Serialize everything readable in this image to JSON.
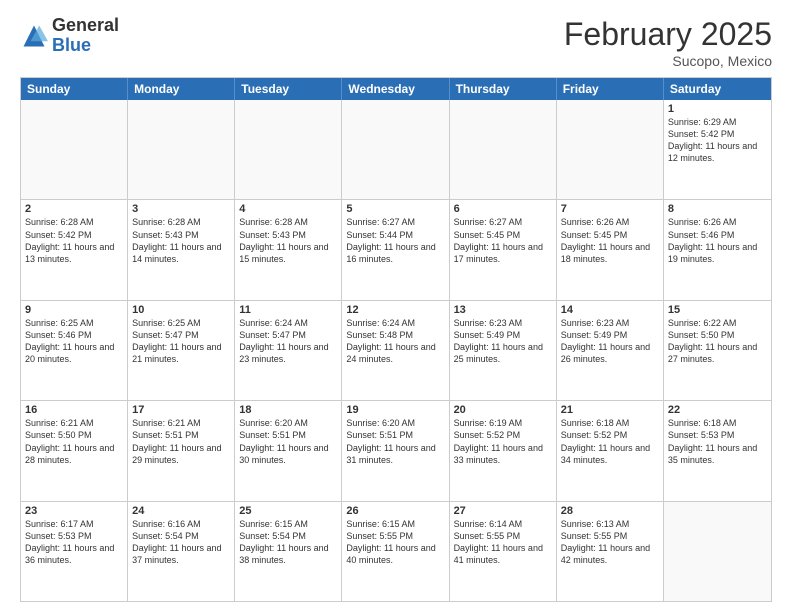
{
  "header": {
    "logo_general": "General",
    "logo_blue": "Blue",
    "month_year": "February 2025",
    "location": "Sucopo, Mexico"
  },
  "days_of_week": [
    "Sunday",
    "Monday",
    "Tuesday",
    "Wednesday",
    "Thursday",
    "Friday",
    "Saturday"
  ],
  "weeks": [
    [
      {
        "day": "",
        "text": ""
      },
      {
        "day": "",
        "text": ""
      },
      {
        "day": "",
        "text": ""
      },
      {
        "day": "",
        "text": ""
      },
      {
        "day": "",
        "text": ""
      },
      {
        "day": "",
        "text": ""
      },
      {
        "day": "1",
        "text": "Sunrise: 6:29 AM\nSunset: 5:42 PM\nDaylight: 11 hours and 12 minutes."
      }
    ],
    [
      {
        "day": "2",
        "text": "Sunrise: 6:28 AM\nSunset: 5:42 PM\nDaylight: 11 hours and 13 minutes."
      },
      {
        "day": "3",
        "text": "Sunrise: 6:28 AM\nSunset: 5:43 PM\nDaylight: 11 hours and 14 minutes."
      },
      {
        "day": "4",
        "text": "Sunrise: 6:28 AM\nSunset: 5:43 PM\nDaylight: 11 hours and 15 minutes."
      },
      {
        "day": "5",
        "text": "Sunrise: 6:27 AM\nSunset: 5:44 PM\nDaylight: 11 hours and 16 minutes."
      },
      {
        "day": "6",
        "text": "Sunrise: 6:27 AM\nSunset: 5:45 PM\nDaylight: 11 hours and 17 minutes."
      },
      {
        "day": "7",
        "text": "Sunrise: 6:26 AM\nSunset: 5:45 PM\nDaylight: 11 hours and 18 minutes."
      },
      {
        "day": "8",
        "text": "Sunrise: 6:26 AM\nSunset: 5:46 PM\nDaylight: 11 hours and 19 minutes."
      }
    ],
    [
      {
        "day": "9",
        "text": "Sunrise: 6:25 AM\nSunset: 5:46 PM\nDaylight: 11 hours and 20 minutes."
      },
      {
        "day": "10",
        "text": "Sunrise: 6:25 AM\nSunset: 5:47 PM\nDaylight: 11 hours and 21 minutes."
      },
      {
        "day": "11",
        "text": "Sunrise: 6:24 AM\nSunset: 5:47 PM\nDaylight: 11 hours and 23 minutes."
      },
      {
        "day": "12",
        "text": "Sunrise: 6:24 AM\nSunset: 5:48 PM\nDaylight: 11 hours and 24 minutes."
      },
      {
        "day": "13",
        "text": "Sunrise: 6:23 AM\nSunset: 5:49 PM\nDaylight: 11 hours and 25 minutes."
      },
      {
        "day": "14",
        "text": "Sunrise: 6:23 AM\nSunset: 5:49 PM\nDaylight: 11 hours and 26 minutes."
      },
      {
        "day": "15",
        "text": "Sunrise: 6:22 AM\nSunset: 5:50 PM\nDaylight: 11 hours and 27 minutes."
      }
    ],
    [
      {
        "day": "16",
        "text": "Sunrise: 6:21 AM\nSunset: 5:50 PM\nDaylight: 11 hours and 28 minutes."
      },
      {
        "day": "17",
        "text": "Sunrise: 6:21 AM\nSunset: 5:51 PM\nDaylight: 11 hours and 29 minutes."
      },
      {
        "day": "18",
        "text": "Sunrise: 6:20 AM\nSunset: 5:51 PM\nDaylight: 11 hours and 30 minutes."
      },
      {
        "day": "19",
        "text": "Sunrise: 6:20 AM\nSunset: 5:51 PM\nDaylight: 11 hours and 31 minutes."
      },
      {
        "day": "20",
        "text": "Sunrise: 6:19 AM\nSunset: 5:52 PM\nDaylight: 11 hours and 33 minutes."
      },
      {
        "day": "21",
        "text": "Sunrise: 6:18 AM\nSunset: 5:52 PM\nDaylight: 11 hours and 34 minutes."
      },
      {
        "day": "22",
        "text": "Sunrise: 6:18 AM\nSunset: 5:53 PM\nDaylight: 11 hours and 35 minutes."
      }
    ],
    [
      {
        "day": "23",
        "text": "Sunrise: 6:17 AM\nSunset: 5:53 PM\nDaylight: 11 hours and 36 minutes."
      },
      {
        "day": "24",
        "text": "Sunrise: 6:16 AM\nSunset: 5:54 PM\nDaylight: 11 hours and 37 minutes."
      },
      {
        "day": "25",
        "text": "Sunrise: 6:15 AM\nSunset: 5:54 PM\nDaylight: 11 hours and 38 minutes."
      },
      {
        "day": "26",
        "text": "Sunrise: 6:15 AM\nSunset: 5:55 PM\nDaylight: 11 hours and 40 minutes."
      },
      {
        "day": "27",
        "text": "Sunrise: 6:14 AM\nSunset: 5:55 PM\nDaylight: 11 hours and 41 minutes."
      },
      {
        "day": "28",
        "text": "Sunrise: 6:13 AM\nSunset: 5:55 PM\nDaylight: 11 hours and 42 minutes."
      },
      {
        "day": "",
        "text": ""
      }
    ]
  ]
}
